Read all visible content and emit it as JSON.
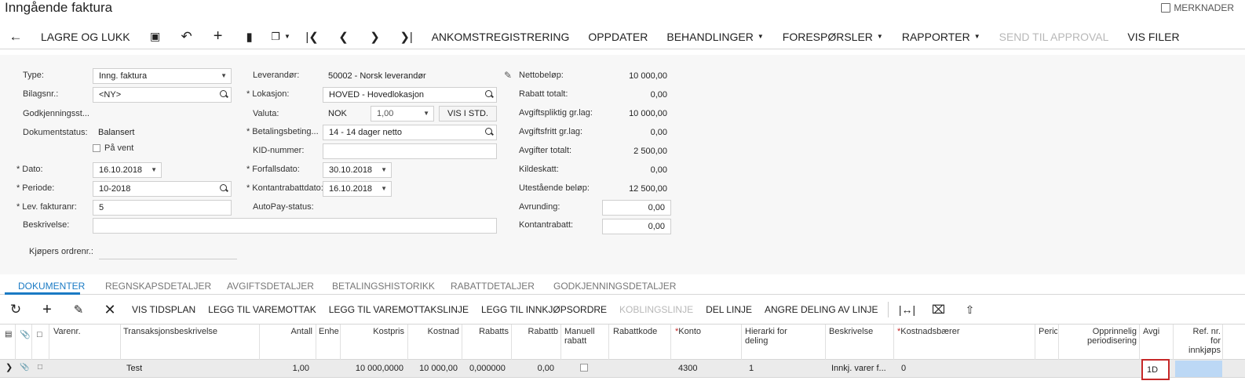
{
  "window": {
    "title": "Inngående faktura",
    "notes_label": "MERKNADER"
  },
  "toolbar": {
    "save_close_label": "LAGRE OG LUKK",
    "arrival_label": "ANKOMSTREGISTRERING",
    "update_label": "OPPDATER",
    "actions_label": "BEHANDLINGER",
    "inquiries_label": "FORESPØRSLER",
    "reports_label": "RAPPORTER",
    "send_approval_label": "SEND TIL APPROVAL",
    "show_files_label": "VIS FILER"
  },
  "form": {
    "type_label": "Type:",
    "type_value": "Inng. faktura",
    "docnr_label": "Bilagsnr.:",
    "docnr_value": "<NY>",
    "approval_label": "Godkjenningsst...",
    "docstatus_label": "Dokumentstatus:",
    "docstatus_value": "Balansert",
    "onhold_label": "På vent",
    "date_label": "Dato:",
    "date_value": "16.10.2018",
    "period_label": "Periode:",
    "period_value": "10-2018",
    "vendor_invoice_label": "Lev. fakturanr:",
    "vendor_invoice_value": "5",
    "description_label": "Beskrivelse:",
    "description_value": "",
    "buyer_order_label": "Kjøpers ordrenr.:",
    "vendor_label": "Leverandør:",
    "vendor_value": "50002 - Norsk leverandør",
    "location_label": "Lokasjon:",
    "location_value": "HOVED - Hovedlokasjon",
    "currency_label": "Valuta:",
    "currency_value": "NOK",
    "rate_value": "1,00",
    "view_std_label": "VIS I STD.",
    "terms_label": "Betalingsbeting...",
    "terms_value": "14 - 14 dager netto",
    "kid_label": "KID-nummer:",
    "kid_value": "",
    "due_date_label": "Forfallsdato:",
    "due_date_value": "30.10.2018",
    "cash_discount_date_label": "Kontantrabattdato:",
    "cash_discount_date_value": "16.10.2018",
    "autopay_label": "AutoPay-status:",
    "net_label": "Nettobeløp:",
    "net_value": "10 000,00",
    "discount_total_label": "Rabatt totalt:",
    "discount_total_value": "0,00",
    "taxable_label": "Avgiftspliktig gr.lag:",
    "taxable_value": "10 000,00",
    "exempt_label": "Avgiftsfritt gr.lag:",
    "exempt_value": "0,00",
    "tax_total_label": "Avgifter totalt:",
    "tax_total_value": "2 500,00",
    "withholding_label": "Kildeskatt:",
    "withholding_value": "0,00",
    "outstanding_label": "Utestående beløp:",
    "outstanding_value": "12 500,00",
    "rounding_label": "Avrunding:",
    "rounding_value": "0,00",
    "cash_discount_label": "Kontantrabatt:",
    "cash_discount_value": "0,00"
  },
  "tabs": [
    "DOKUMENTER",
    "REGNSKAPSDETALJER",
    "AVGIFTSDETALJER",
    "BETALINGSHISTORIKK",
    "RABATTDETALJER",
    "GODKJENNINGSDETALJER"
  ],
  "grid_toolbar": {
    "schedule_label": "VIS TIDSPLAN",
    "add_receipt_label": "LEGG TIL VAREMOTTAK",
    "add_receipt_line_label": "LEGG TIL VAREMOTTAKSLINJE",
    "add_po_label": "LEGG TIL INNKJØPSORDRE",
    "link_line_label": "KOBLINGSLINJE",
    "split_line_label": "DEL LINJE",
    "undo_split_label": "ANGRE DELING AV LINJE"
  },
  "grid": {
    "headers": {
      "item": "Varenr.",
      "trandesc": "Transaksjonsbeskrivelse",
      "qty": "Antall",
      "uom": "Enhe",
      "unit_cost": "Kostpris",
      "cost": "Kostnad",
      "disc_pct": "Rabatts",
      "disc_amt": "Rabattb",
      "manual_disc_1": "Manuell",
      "manual_disc_2": "rabatt",
      "disc_code": "Rabattkode",
      "account": "Konto",
      "hier_1": "Hierarki for",
      "hier_2": "deling",
      "description": "Beskrivelse",
      "cost_bearer": "Kostnadsbærer",
      "period": "Peric",
      "orig_deferral_1": "Opprinnelig",
      "orig_deferral_2": "periodisering",
      "tax": "Avgi",
      "ref_1": "Ref. nr.",
      "ref_2": "for",
      "ref_3": "innkjøps"
    },
    "rows": [
      {
        "item": "",
        "trandesc": "Test",
        "qty": "1,00",
        "uom": "",
        "unit_cost": "10 000,0000",
        "cost": "10 000,00",
        "disc_pct": "0,000000",
        "disc_amt": "0,00",
        "disc_code": "",
        "account": "4300",
        "hier": "1",
        "description": "Innkj. varer f...",
        "cost_bearer": "0",
        "tax": "1D"
      }
    ]
  }
}
